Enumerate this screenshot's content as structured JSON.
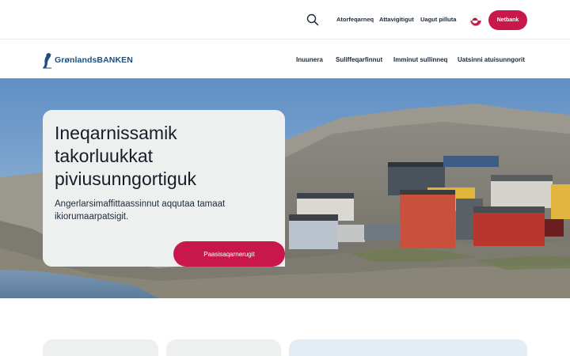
{
  "topbar": {
    "links": [
      "Atorfeqarneq",
      "Attavigitigut",
      "Uagut pilluta"
    ],
    "netbank_label": "Netbank"
  },
  "logo": {
    "text_part1": "Grønlands",
    "text_part2": "BANKEN"
  },
  "nav": {
    "items": [
      "Inuunera",
      "Suliffeqarfinnut",
      "Imminut sullinneq",
      "Uatsinni atuisunngorit"
    ]
  },
  "hero": {
    "title": "Ineqarnissamik takorluukkat piviusunngortiguk",
    "subtitle": "Angerlarsimaffittaassinnut aqqutaa tamaat ikiorumaarpatsigit.",
    "cta_label": "Paasisaqarnerugit"
  },
  "colors": {
    "accent": "#c8174b",
    "brand": "#1d4f7c",
    "card_bg": "#eef0f0"
  },
  "icons": {
    "search": "search-icon",
    "flag": "greenland-flag-icon"
  }
}
